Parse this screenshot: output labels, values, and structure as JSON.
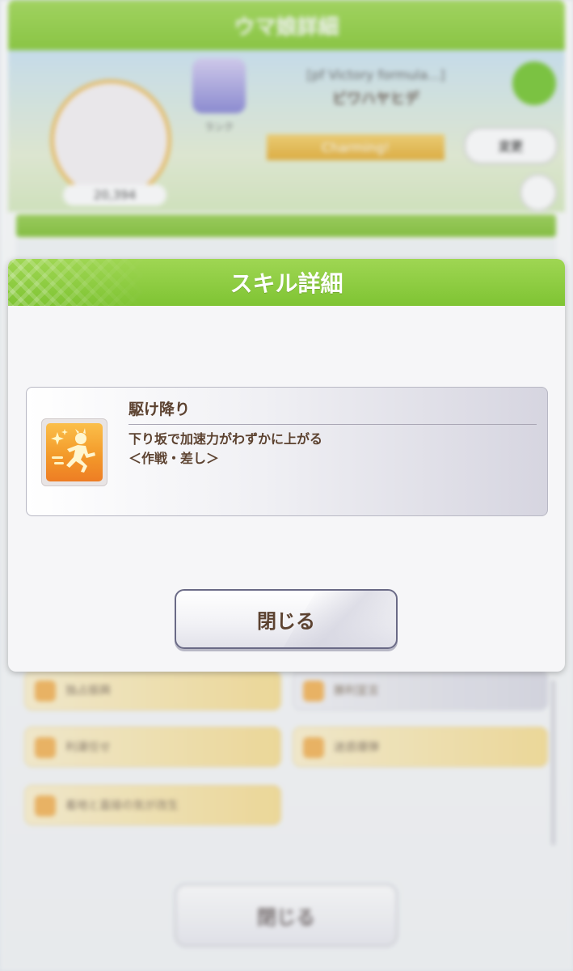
{
  "background": {
    "header_title": "ウマ娘詳細",
    "profile": {
      "title": "[pf Victory formula...]",
      "name": "ビワハヤヒデ",
      "score": "20,394",
      "rank_label": "ランク",
      "ribbon": "Charming!",
      "change_button": "変更"
    },
    "skills": [
      {
        "label": "独占振興"
      },
      {
        "label": "勝利宣言"
      },
      {
        "label": "利運任せ"
      },
      {
        "label": "迷惑爆弾"
      },
      {
        "label": "着地と直接の気が改生"
      }
    ],
    "close_label": "閉じる"
  },
  "dialog": {
    "title": "スキル詳細",
    "skill": {
      "icon": "speed-up-runner-icon",
      "name": "駆け降り",
      "description": "下り坂で加速力がわずかに上がる",
      "tag": "＜作戦・差し＞"
    },
    "close_label": "閉じる"
  },
  "colors": {
    "header_green": "#8ccd3d",
    "text_brown": "#5c4230",
    "icon_orange": "#f39a2a"
  }
}
